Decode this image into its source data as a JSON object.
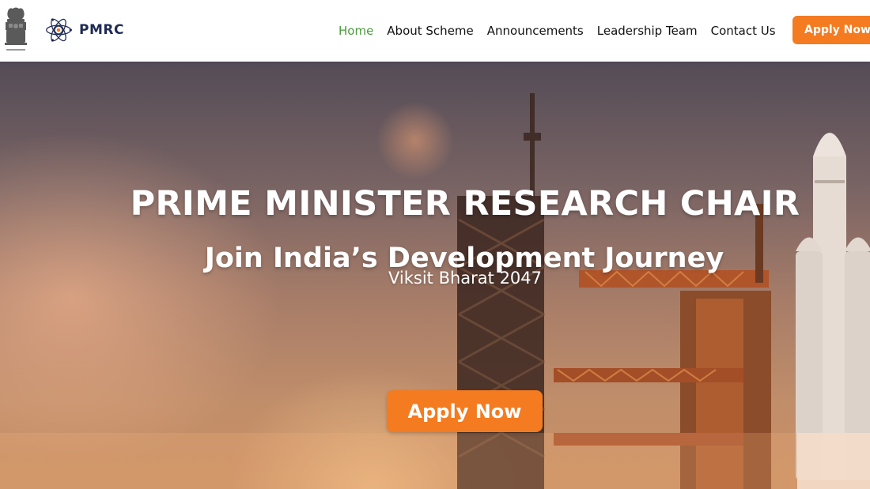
{
  "header": {
    "brand_name": "PMRC",
    "emblem_icon": "national-emblem-icon",
    "logo_icon": "atom-logo-icon",
    "apply_button_label": "Apply Now"
  },
  "nav": {
    "items": [
      {
        "label": "Home",
        "active": true
      },
      {
        "label": "About Scheme",
        "active": false
      },
      {
        "label": "Announcements",
        "active": false
      },
      {
        "label": "Leadership Team",
        "active": false
      },
      {
        "label": "Contact Us",
        "active": false
      }
    ]
  },
  "hero": {
    "title": "PRIME MINISTER RESEARCH CHAIR",
    "subtitle": "Join India’s Development Journey",
    "tagline": "Viksit Bharat 2047",
    "apply_button_label": "Apply Now"
  },
  "colors": {
    "accent": "#f47b20",
    "nav_active": "#4b9a3c",
    "brand_text": "#1e2a55"
  }
}
